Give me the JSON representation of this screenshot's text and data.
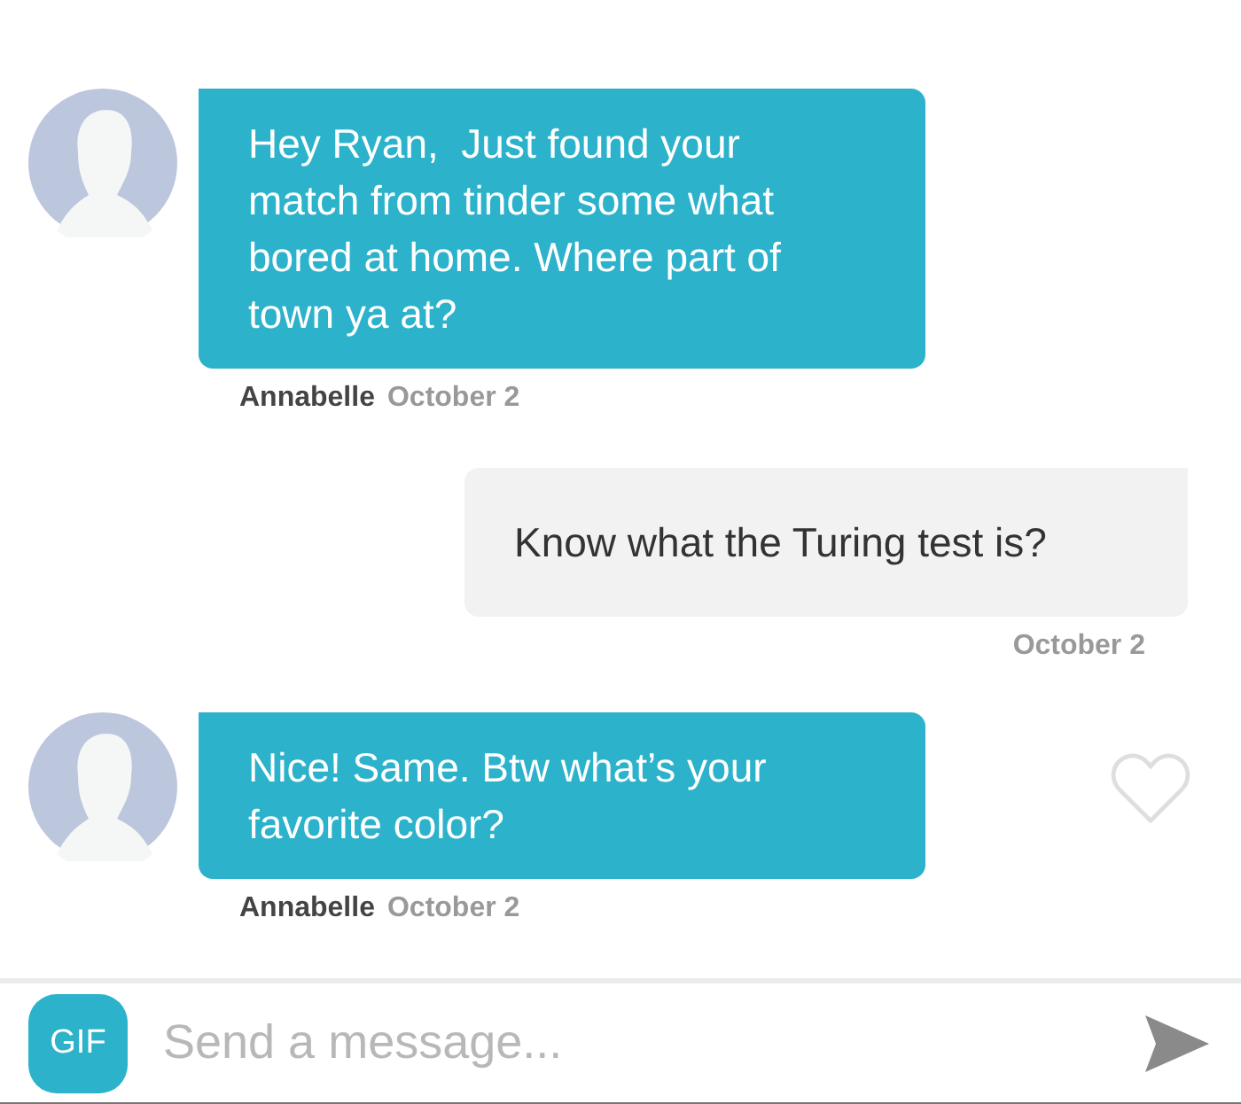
{
  "messages": [
    {
      "kind": "incoming",
      "text": "Hey Ryan,  Just found your match from tinder some what bored at home. Where part of town ya at?",
      "sender": "Annabelle",
      "date": "October 2"
    },
    {
      "kind": "outgoing",
      "text": "Know what the Turing test is?",
      "date": "October 2"
    },
    {
      "kind": "incoming",
      "text": "Nice! Same. Btw what’s your favorite color?",
      "sender": "Annabelle",
      "date": "October 2",
      "liked": false
    }
  ],
  "composer": {
    "gif_label": "GIF",
    "placeholder": "Send a message..."
  }
}
